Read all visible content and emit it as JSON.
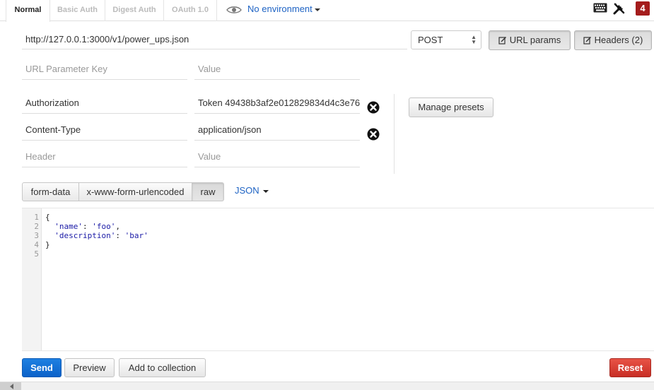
{
  "tabs": [
    {
      "label": "Normal",
      "active": true
    },
    {
      "label": "Basic Auth",
      "active": false
    },
    {
      "label": "Digest Auth",
      "active": false
    },
    {
      "label": "OAuth 1.0",
      "active": false
    }
  ],
  "environment": {
    "label": "No environment",
    "icon": "eye-icon"
  },
  "toolbar": {
    "keyboard_icon": "keyboard-icon",
    "settings_icon": "wrench-icon",
    "notification_count": "4",
    "badge_color": "#a41c1c"
  },
  "request": {
    "url": "http://127.0.0.1:3000/v1/power_ups.json",
    "method": "POST",
    "url_params_label": "URL params",
    "headers_label": "Headers (2)"
  },
  "url_params": {
    "key_placeholder": "URL Parameter Key",
    "value_placeholder": "Value"
  },
  "headers": {
    "rows": [
      {
        "key": "Authorization",
        "value": "Token 49438b3af2e012829834d4c3e76"
      },
      {
        "key": "Content-Type",
        "value": "application/json"
      }
    ],
    "key_placeholder": "Header",
    "value_placeholder": "Value",
    "manage_presets_label": "Manage presets"
  },
  "body_modes": [
    "form-data",
    "x-www-form-urlencoded",
    "raw"
  ],
  "active_body_mode": "raw",
  "language": "JSON",
  "editor": {
    "line_numbers": [
      "1",
      "2",
      "3",
      "4",
      "5"
    ],
    "lines": [
      {
        "prefix": "{",
        "key": "",
        "sep": "",
        "value": "",
        "suffix": ""
      },
      {
        "prefix": "  ",
        "key": "'name'",
        "sep": ": ",
        "value": "'foo'",
        "suffix": ","
      },
      {
        "prefix": "  ",
        "key": "'description'",
        "sep": ": ",
        "value": "'bar'",
        "suffix": ""
      },
      {
        "prefix": "}",
        "key": "",
        "sep": "",
        "value": "",
        "suffix": ""
      },
      {
        "prefix": "",
        "key": "",
        "sep": "",
        "value": "",
        "suffix": ""
      }
    ]
  },
  "actions": {
    "send": "Send",
    "preview": "Preview",
    "add_to_collection": "Add to collection",
    "reset": "Reset"
  },
  "colors": {
    "accent": "#1e63c4",
    "send": "#0b62c9",
    "reset": "#c82e25"
  }
}
